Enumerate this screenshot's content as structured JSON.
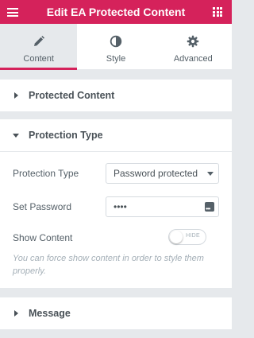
{
  "header": {
    "title": "Edit EA Protected Content",
    "accent_color": "#d5225b",
    "left_icon": "hamburger-icon",
    "right_icon": "apps-grid-icon"
  },
  "tabs": [
    {
      "label": "Content",
      "icon": "pencil-icon",
      "active": true
    },
    {
      "label": "Style",
      "icon": "half-circle-icon",
      "active": false
    },
    {
      "label": "Advanced",
      "icon": "gear-icon",
      "active": false
    }
  ],
  "sections": {
    "protected_content": {
      "label": "Protected Content",
      "expanded": false
    },
    "protection_type": {
      "label": "Protection Type",
      "expanded": true,
      "fields": {
        "protection_type_label": "Protection Type",
        "protection_type_value": "Password protected",
        "set_password_label": "Set Password",
        "set_password_value": "••••",
        "show_content_label": "Show Content",
        "show_content_toggle": "HIDE",
        "help_text": "You can force show content in order to style them properly."
      }
    },
    "message": {
      "label": "Message",
      "expanded": false
    }
  }
}
